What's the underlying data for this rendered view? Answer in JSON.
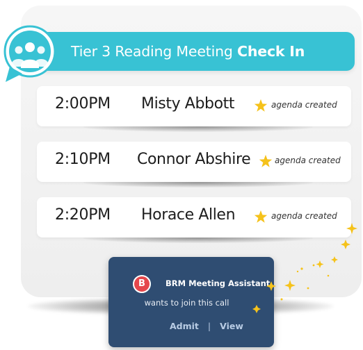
{
  "header": {
    "title_regular": "Tier 3 Reading Meeting ",
    "title_bold": "Check In",
    "icon": "group-people-chat-icon"
  },
  "schedule": [
    {
      "time": "2:00PM",
      "name": "Misty Abbott",
      "status": "agenda created",
      "icon": "star-icon"
    },
    {
      "time": "2:10PM",
      "name": "Connor Abshire",
      "status": "agenda created",
      "icon": "star-icon"
    },
    {
      "time": "2:20PM",
      "name": "Horace Allen",
      "status": "agenda created",
      "icon": "star-icon"
    }
  ],
  "notification": {
    "avatar_letter": "B",
    "sender": "BRM Meeting Assistant",
    "message": "wants to join this call",
    "admit_label": "Admit",
    "separator": "|",
    "view_label": "View"
  },
  "colors": {
    "header": "#38c2d4",
    "notification": "#2f4d72",
    "avatar": "#e5474c",
    "star": "#f5c21b"
  }
}
